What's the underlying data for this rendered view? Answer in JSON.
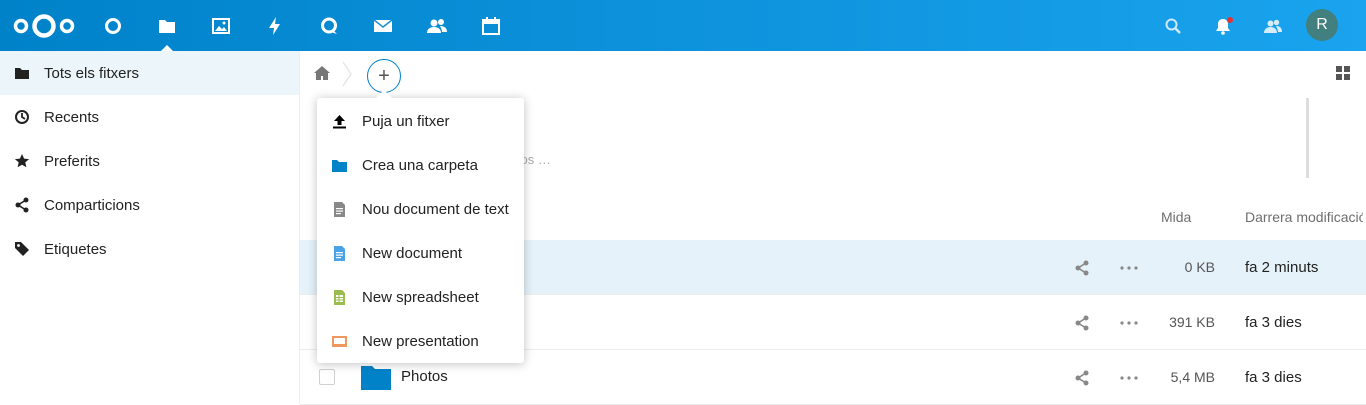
{
  "header": {
    "apps": [
      {
        "name": "dashboard-app-icon",
        "label": "Dashboard"
      },
      {
        "name": "files-app-icon",
        "label": "Files",
        "active": true
      },
      {
        "name": "photos-app-icon",
        "label": "Photos"
      },
      {
        "name": "activity-app-icon",
        "label": "Activity"
      },
      {
        "name": "talk-app-icon",
        "label": "Talk"
      },
      {
        "name": "mail-app-icon",
        "label": "Mail"
      },
      {
        "name": "contacts-app-icon",
        "label": "Contacts"
      },
      {
        "name": "calendar-app-icon",
        "label": "Calendar"
      }
    ],
    "avatar_initial": "R",
    "accent": "#0082c9"
  },
  "sidebar": {
    "items": [
      {
        "label": "Tots els fitxers",
        "icon": "folder-icon",
        "active": true
      },
      {
        "label": "Recents",
        "icon": "clock-icon"
      },
      {
        "label": "Preferits",
        "icon": "star-icon"
      },
      {
        "label": "Comparticions",
        "icon": "share-icon"
      },
      {
        "label": "Etiquetes",
        "icon": "tag-icon"
      }
    ]
  },
  "main": {
    "add_button_label": "+",
    "faded_text": "ços …",
    "columns": {
      "size": "Mida",
      "modified": "Darrera modificació"
    },
    "rows": [
      {
        "name": "",
        "size": "0 KB",
        "modified": "fa 2 minuts",
        "selected": true
      },
      {
        "name": "",
        "size": "391 KB",
        "modified": "fa 3 dies"
      },
      {
        "name": "Photos",
        "size": "5,4 MB",
        "modified": "fa 3 dies"
      }
    ]
  },
  "new_menu": {
    "items": [
      {
        "label": "Puja un fitxer",
        "icon": "upload-icon"
      },
      {
        "label": "Crea una carpeta",
        "icon": "folder-icon",
        "color": "#0082c9"
      },
      {
        "label": "Nou document de text",
        "icon": "text-file-icon",
        "color": "#888888"
      },
      {
        "label": "New document",
        "icon": "document-icon",
        "color": "#49a3e6"
      },
      {
        "label": "New spreadsheet",
        "icon": "spreadsheet-icon",
        "color": "#9abd4e"
      },
      {
        "label": "New presentation",
        "icon": "presentation-icon",
        "color": "#f0965f"
      }
    ]
  }
}
